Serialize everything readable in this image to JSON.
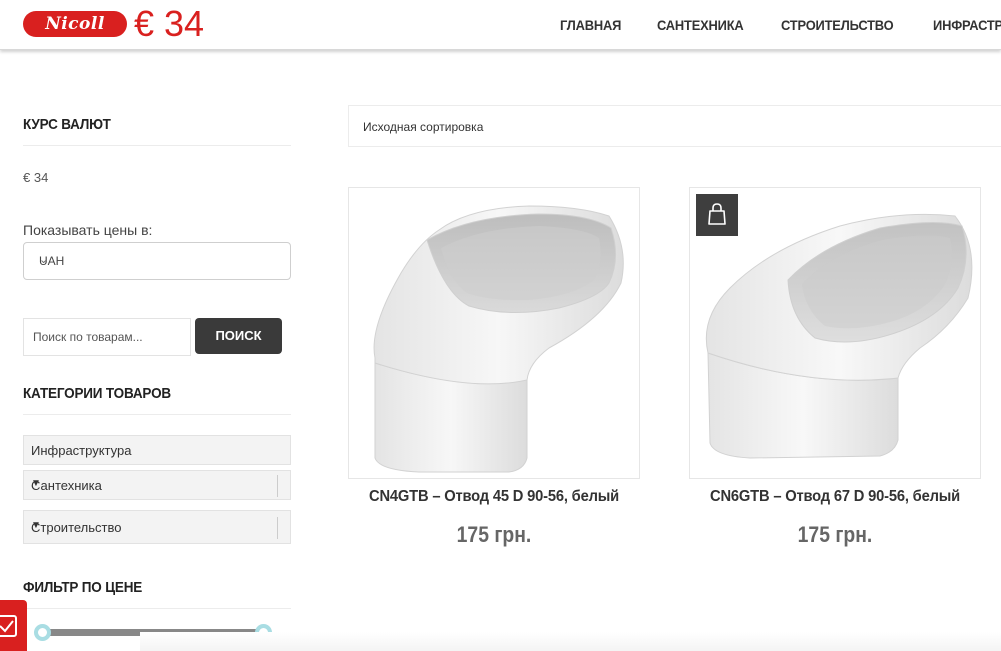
{
  "header": {
    "logo_text": "Nicoll",
    "rate": "€ 34",
    "nav": [
      "ГЛАВНАЯ",
      "САНТЕХНИКА",
      "СТРОИТЕЛЬСТВО",
      "ИНФРАСТРУКТУРА"
    ]
  },
  "sidebar": {
    "currency": {
      "title": "КУРС ВАЛЮТ",
      "rate": "€ 34",
      "show_prices_label": "Показывать цены в:",
      "selected": "UAH"
    },
    "search": {
      "placeholder": "Поиск по товарам...",
      "button": "ПОИСК"
    },
    "categories": {
      "title": "КАТЕГОРИИ ТОВАРОВ",
      "items": [
        "Инфраструктура",
        "Сантехника",
        "Строительство"
      ]
    },
    "price_filter": {
      "title": "ФИЛЬТР ПО ЦЕНЕ"
    }
  },
  "main": {
    "sort_label": "Исходная сортировка",
    "products": [
      {
        "title": "CN4GTB – Отвод 45 D 90-56, белый",
        "price": "175 грн."
      },
      {
        "title": "CN6GTB – Отвод 67 D 90-56, белый",
        "price": "175 грн."
      }
    ]
  },
  "colors": {
    "accent": "#d9201f",
    "dark_button": "#3a3a3a",
    "slider_handle": "#a9dde3"
  }
}
